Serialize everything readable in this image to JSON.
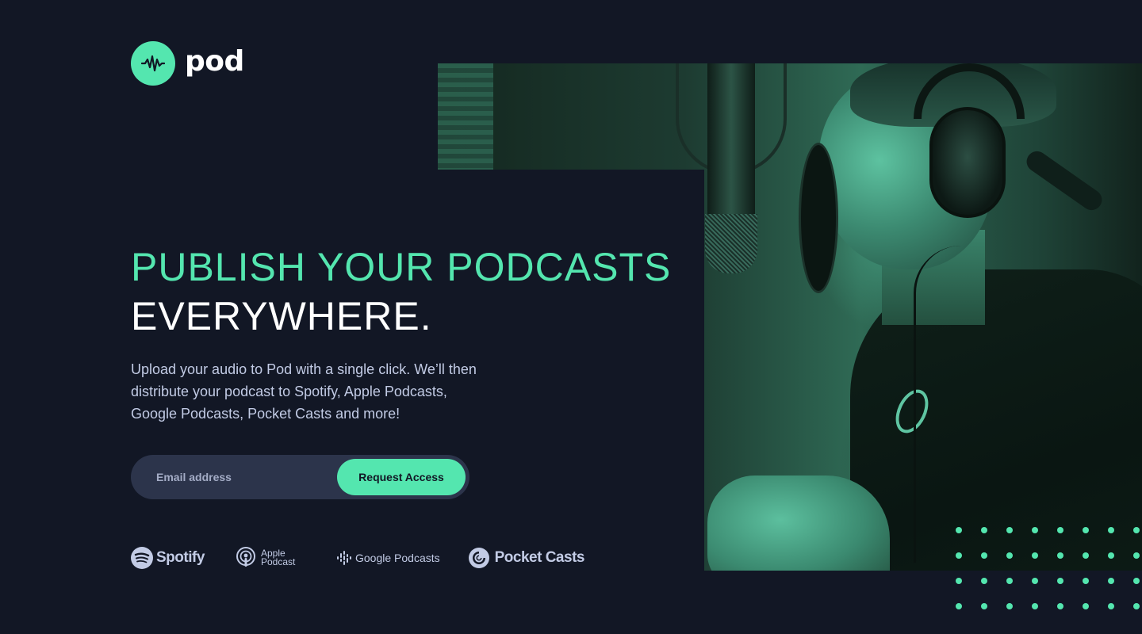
{
  "brand": {
    "name": "pod",
    "logo_icon": "waveform-icon",
    "accent_color": "#54E6AF",
    "background_color": "#121725"
  },
  "hero": {
    "headline_line1": "PUBLISH YOUR PODCASTS",
    "headline_line2": "EVERYWHERE.",
    "description": "Upload your audio to Pod with a single click. We’ll then distribute your podcast to Spotify, Apple Podcasts, Google Podcasts, Pocket Casts and more!",
    "image_alt": "podcast-host-at-microphone-photo"
  },
  "signup": {
    "email_placeholder": "Email address",
    "email_value": "",
    "submit_label": "Request Access"
  },
  "platforms": [
    {
      "name": "Spotify",
      "icon": "spotify-icon"
    },
    {
      "name_line1": "Apple",
      "name_line2": "Podcast",
      "icon": "apple-podcasts-icon"
    },
    {
      "name": "Google Podcasts",
      "icon": "google-podcasts-icon"
    },
    {
      "name": "Pocket Casts",
      "icon": "pocket-casts-icon"
    }
  ]
}
